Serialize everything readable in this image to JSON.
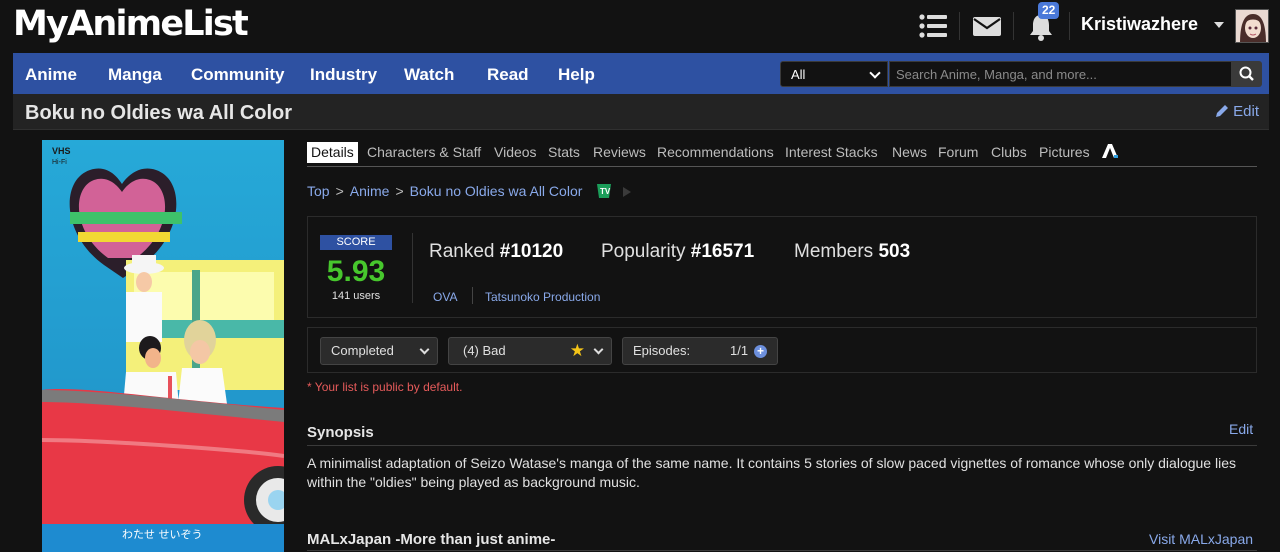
{
  "header": {
    "logo": "MyAnimeList",
    "notification_count": "22",
    "username": "Kristiwazhere",
    "icons": [
      "list-icon",
      "mail-icon",
      "bell-icon",
      "caret-down-icon"
    ]
  },
  "nav": {
    "items": [
      "Anime",
      "Manga",
      "Community",
      "Industry",
      "Watch",
      "Read",
      "Help"
    ],
    "search_category": "All",
    "search_placeholder": "Search Anime, Manga, and more...",
    "search_icon": "search-icon"
  },
  "page": {
    "title": "Boku no Oldies wa All Color",
    "edit_label": "Edit"
  },
  "tabs": [
    "Details",
    "Characters & Staff",
    "Videos",
    "Stats",
    "Reviews",
    "Recommendations",
    "Interest Stacks",
    "News",
    "Forum",
    "Clubs",
    "Pictures"
  ],
  "breadcrumb": [
    "Top",
    "Anime",
    "Boku no Oldies wa All Color"
  ],
  "stats": {
    "score_label": "SCORE",
    "score": "5.93",
    "score_users": "141 users",
    "ranked_label": "Ranked",
    "ranked_value": "#10120",
    "popularity_label": "Popularity",
    "popularity_value": "#16571",
    "members_label": "Members",
    "members_value": "503",
    "type": "OVA",
    "studio": "Tatsunoko Production"
  },
  "list": {
    "status": "Completed",
    "score": "(4) Bad",
    "episodes_label": "Episodes:",
    "episodes_value": "1/1",
    "public_note": "* Your list is public by default."
  },
  "synopsis": {
    "title": "Synopsis",
    "edit_label": "Edit",
    "text": "A minimalist adaptation of Seizo Watase's manga of the same name. It contains 5 stories of slow paced vignettes of romance whose only dialogue lies within the \"oldies\" being played as background music."
  },
  "malxjapan": {
    "title": "MALxJapan -More than just anime-",
    "link": "Visit MALxJapan"
  },
  "cover": {
    "vhs": "VHS",
    "hifi": "Hi-Fi",
    "author": "わたせ せいぞう"
  },
  "colors": {
    "nav_blue": "#2e51a2",
    "link_blue": "#89a9ea",
    "score_green": "#47c72d"
  }
}
